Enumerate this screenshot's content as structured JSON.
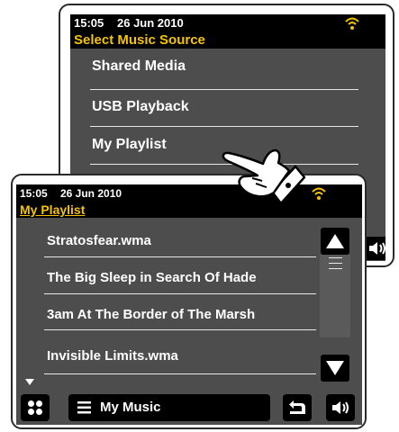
{
  "back_screen": {
    "status": {
      "time": "15:05",
      "date": "26 Jun 2010"
    },
    "title": "Select Music Source",
    "items": [
      {
        "label": "Shared Media"
      },
      {
        "label": "USB Playback"
      },
      {
        "label": "My Playlist"
      }
    ]
  },
  "front_screen": {
    "status": {
      "time": "15:05",
      "date": "26 Jun 2010"
    },
    "title": "My Playlist",
    "items": [
      {
        "label": "Stratosfear.wma"
      },
      {
        "label": "The Big Sleep in Search Of Hade"
      },
      {
        "label": "3am At The Border of The Marsh"
      },
      {
        "label": "Invisible Limits.wma"
      }
    ],
    "toolbar": {
      "music_label": "My Music"
    }
  },
  "colors": {
    "title": "#f5c400",
    "screen_bg": "#4d4d4d",
    "wifi": "#f5c400"
  },
  "icons": [
    "wifi-icon",
    "volume-icon",
    "scroll-up-icon",
    "scroll-down-icon",
    "grid-menu-icon",
    "list-icon",
    "back-icon",
    "hand-pointer-icon"
  ]
}
